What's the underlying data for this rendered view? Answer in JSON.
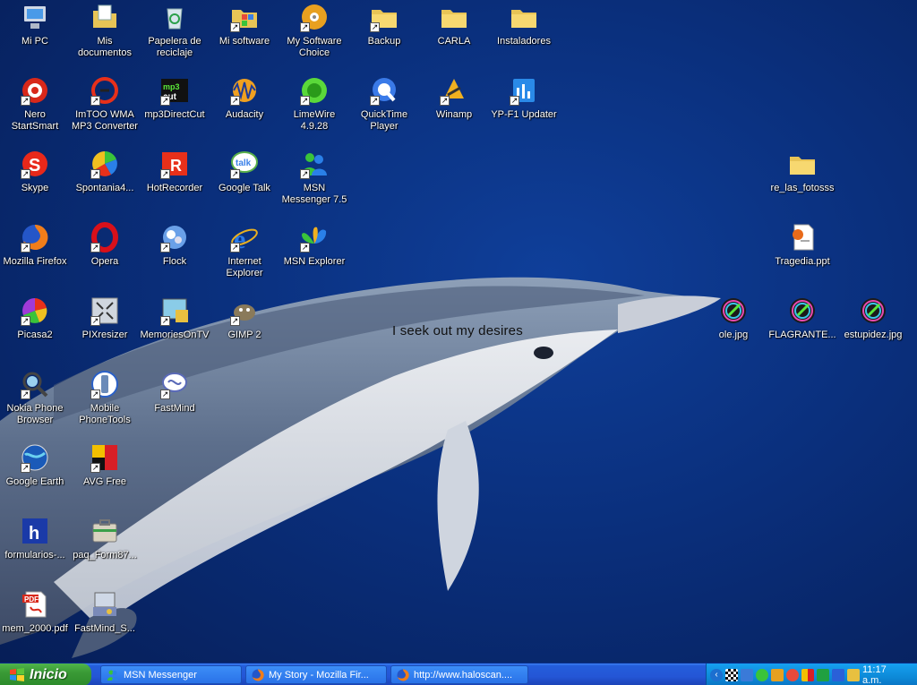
{
  "desktop": {
    "overlay_text": "I seek out my desires",
    "icons": [
      {
        "label": "Mi PC",
        "icon": "my-computer-icon"
      },
      {
        "label": "Mis documentos",
        "icon": "my-documents-icon"
      },
      {
        "label": "Papelera de reciclaje",
        "icon": "recycle-bin-icon"
      },
      {
        "label": "Mi software",
        "icon": "software-icon"
      },
      {
        "label": "My Software Choice",
        "icon": "software-choice-icon"
      },
      {
        "label": "Backup",
        "icon": "folder-icon"
      },
      {
        "label": "CARLA",
        "icon": "folder-icon"
      },
      {
        "label": "Instaladores",
        "icon": "folder-icon"
      },
      {
        "label": "Nero StartSmart",
        "icon": "nero-icon"
      },
      {
        "label": "ImTOO WMA MP3 Converter",
        "icon": "converter-icon"
      },
      {
        "label": "mp3DirectCut",
        "icon": "mp3directcut-icon"
      },
      {
        "label": "Audacity",
        "icon": "audacity-icon"
      },
      {
        "label": "LimeWire 4.9.28",
        "icon": "limewire-icon"
      },
      {
        "label": "QuickTime Player",
        "icon": "quicktime-icon"
      },
      {
        "label": "Winamp",
        "icon": "winamp-icon"
      },
      {
        "label": "YP-F1 Updater",
        "icon": "updater-icon"
      },
      {
        "label": "Skype",
        "icon": "skype-icon"
      },
      {
        "label": "Spontania4...",
        "icon": "spontania-icon"
      },
      {
        "label": "HotRecorder",
        "icon": "hotrecorder-icon"
      },
      {
        "label": "Google Talk",
        "icon": "google-talk-icon"
      },
      {
        "label": "MSN Messenger 7.5",
        "icon": "msn-messenger-icon"
      },
      {
        "label": "re_las_fotosss",
        "icon": "folder-icon"
      },
      {
        "label": "Mozilla Firefox",
        "icon": "firefox-icon"
      },
      {
        "label": "Opera",
        "icon": "opera-icon"
      },
      {
        "label": "Flock",
        "icon": "flock-icon"
      },
      {
        "label": "Internet Explorer",
        "icon": "internet-explorer-icon"
      },
      {
        "label": "MSN Explorer",
        "icon": "msn-explorer-icon"
      },
      {
        "label": "Tragedia.ppt",
        "icon": "powerpoint-file-icon"
      },
      {
        "label": "Picasa2",
        "icon": "picasa-icon"
      },
      {
        "label": "PIXresizer",
        "icon": "pixresizer-icon"
      },
      {
        "label": "MemoriesOnTV",
        "icon": "memoriesontv-icon"
      },
      {
        "label": "GIMP 2",
        "icon": "gimp-icon"
      },
      {
        "label": "ole.jpg",
        "icon": "image-file-icon"
      },
      {
        "label": "FLAGRANTE...",
        "icon": "image-file-icon"
      },
      {
        "label": "estupidez.jpg",
        "icon": "image-file-icon"
      },
      {
        "label": "Nokia Phone Browser",
        "icon": "nokia-browser-icon"
      },
      {
        "label": "Mobile PhoneTools",
        "icon": "mobile-phonetools-icon"
      },
      {
        "label": "FastMind",
        "icon": "fastmind-icon"
      },
      {
        "label": "Google Earth",
        "icon": "google-earth-icon"
      },
      {
        "label": "AVG Free",
        "icon": "avg-icon"
      },
      {
        "label": "formularios-...",
        "icon": "formularios-icon"
      },
      {
        "label": "paq_Form87...",
        "icon": "package-icon"
      },
      {
        "label": "mem_2000.pdf",
        "icon": "pdf-file-icon"
      },
      {
        "label": "FastMind_S...",
        "icon": "installer-icon"
      }
    ]
  },
  "taskbar": {
    "start_label": "Inicio",
    "tasks": [
      {
        "label": "MSN Messenger",
        "icon": "msn-messenger-icon"
      },
      {
        "label": "My Story - Mozilla Fir...",
        "icon": "firefox-icon"
      },
      {
        "label": "http://www.haloscan....",
        "icon": "firefox-icon"
      }
    ],
    "tray": {
      "clock": "11:17 a.m.",
      "icons": [
        "tray-expand-icon",
        "checkered-flag-icon",
        "network-icon",
        "msn-tray-icon",
        "user-tray-icon",
        "chat-tray-icon",
        "antivirus-tray-icon",
        "winamp-tray-icon",
        "bluetooth-tray-icon",
        "monitor-tray-icon"
      ]
    }
  },
  "colors": {
    "desktop_bg": "#0a2f7c",
    "taskbar_blue": "#245edb",
    "start_green": "#3a9a36",
    "tray_blue": "#0d8ad8"
  }
}
